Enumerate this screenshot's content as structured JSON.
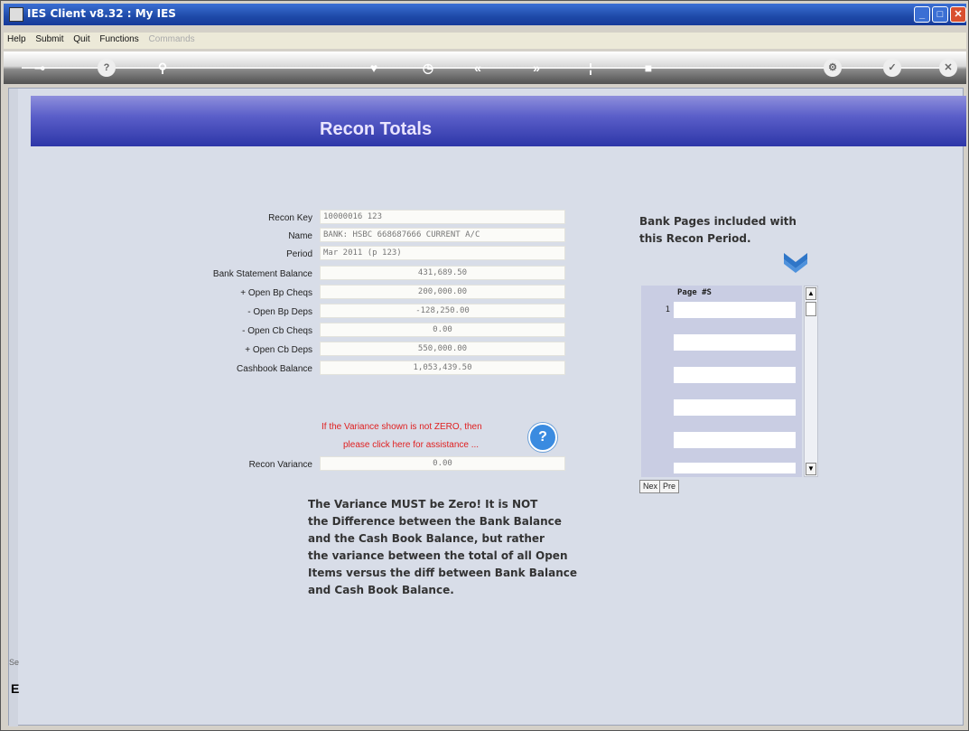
{
  "window": {
    "title": "IES Client v8.32 : My IES"
  },
  "menu": {
    "items": [
      "Help",
      "Submit",
      "Quit",
      "Functions"
    ],
    "disabled_item": "Commands"
  },
  "toolbar": {
    "icons": [
      "key-icon",
      "help-icon",
      "search-icon",
      "heart-icon",
      "clock-icon",
      "back-icon",
      "forward-icon",
      "info-icon",
      "stop-icon",
      "settings-icon",
      "check-icon",
      "close-icon"
    ]
  },
  "banner": {
    "title": "Recon Totals"
  },
  "form": {
    "labels": {
      "recon_key": "Recon Key",
      "name": "Name",
      "period": "Period",
      "bank_balance": "Bank Statement Balance",
      "open_bp_cheqs": "+ Open Bp Cheqs",
      "open_bp_deps": "- Open Bp Deps",
      "open_cb_cheqs": "- Open Cb Cheqs",
      "open_cb_deps": "+ Open Cb Deps",
      "cashbook_balance": "Cashbook Balance",
      "recon_variance": "Recon Variance"
    },
    "values": {
      "recon_key": "10000016        123",
      "name": "BANK: HSBC 668687666 CURRENT A/C",
      "period": "Mar 2011 (p 123)",
      "bank_balance": "431,689.50",
      "open_bp_cheqs": "200,000.00",
      "open_bp_deps": "-128,250.00",
      "open_cb_cheqs": "0.00",
      "open_cb_deps": "550,000.00",
      "cashbook_balance": "1,053,439.50",
      "recon_variance": "0.00"
    }
  },
  "warning": {
    "line1": "If the Variance shown is not ZERO, then",
    "line2": "please click here for assistance ..."
  },
  "note": {
    "lines": [
      "The Variance MUST be Zero! It is NOT",
      "the Difference between the Bank Balance",
      "and the Cash Book Balance, but rather",
      "the variance between the total of all Open",
      "Items versus the diff between Bank Balance",
      "and Cash Book Balance."
    ]
  },
  "right_panel": {
    "title_line1": "Bank Pages included with",
    "title_line2": "this Recon Period.",
    "grid_header": "Page #S",
    "first_row_number": "1",
    "next_button": "Nex",
    "prev_button": "Pre"
  },
  "status": {
    "left_label": "Se",
    "left_char": "E"
  },
  "colors": {
    "banner": "#2d36a8",
    "warning": "#e02020",
    "help": "#3a8be0",
    "background": "#d8dde8"
  }
}
